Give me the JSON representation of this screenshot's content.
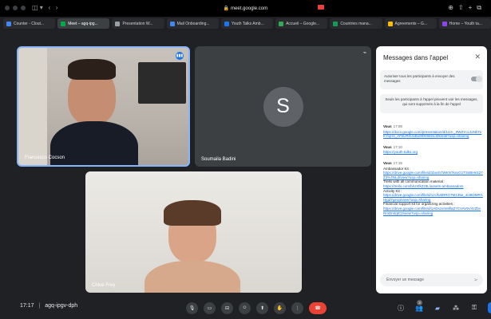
{
  "browser": {
    "url": "meet.google.com",
    "tabs": [
      {
        "label": "Counter - Clout...",
        "icon": "chrome-icon",
        "active": false,
        "color": "#4285f4"
      },
      {
        "label": "Meet – agq-ipg...",
        "icon": "meet-icon",
        "active": true,
        "color": "#00ac47"
      },
      {
        "label": "Presentation W...",
        "icon": "chrome-icon",
        "active": false,
        "color": "#9aa0a6"
      },
      {
        "label": "Mail Onboarding...",
        "icon": "gmail-icon",
        "active": false,
        "color": "#4285f4"
      },
      {
        "label": "Youth Talks Amb...",
        "icon": "facebook-icon",
        "active": false,
        "color": "#1877f2"
      },
      {
        "label": "Accueil – Google...",
        "icon": "drive-icon",
        "active": false,
        "color": "#34a853"
      },
      {
        "label": "Countries mana...",
        "icon": "sheets-icon",
        "active": false,
        "color": "#0f9d58"
      },
      {
        "label": "Agreements – G...",
        "icon": "drive-icon",
        "active": false,
        "color": "#fbbc04"
      },
      {
        "label": "Home – Youth ta...",
        "icon": "notion-icon",
        "active": false,
        "color": "#8e44ec"
      }
    ]
  },
  "participants": [
    {
      "name": "Francesco Cocson",
      "type": "video",
      "speaking": true
    },
    {
      "name": "Soumaila Badini",
      "type": "avatar",
      "initial": "S"
    },
    {
      "name": "Chloe Frey",
      "type": "video"
    }
  ],
  "chat": {
    "title": "Messages dans l'appel",
    "allow_label": "Autoriser tous les participants à envoyer des messages",
    "notice": "Seuls les participants à l'appel peuvent voir les messages, qui sont supprimés à la fin de l'appel",
    "messages": [
      {
        "sender": "Vous",
        "time": "17:08",
        "lines": [
          {
            "type": "link",
            "text": "https://docs.google.com/presentation/d/1U4-_9WZYcL3zNbToKYxjHs_AFkURGJxBv08Xr6M1IJZk/edit?usp=sharing"
          }
        ]
      },
      {
        "sender": "Vous",
        "time": "17:10",
        "lines": [
          {
            "type": "link",
            "text": "https://youth-talks.org"
          }
        ]
      },
      {
        "sender": "Vous",
        "time": "17:15",
        "lines": [
          {
            "type": "text",
            "text": "Ambassador Kit :"
          },
          {
            "type": "link",
            "text": "https://drive.google.com/file/d/1bosh7WKN7ksxG1TSsBHkS27Z3%4NLd/view?usp=sharing"
          },
          {
            "type": "text",
            "text": "Trello with all communication material :"
          },
          {
            "type": "link",
            "text": "https://trello.com/b/UXfkZz8L/assets-ambassadors"
          },
          {
            "type": "text",
            "text": "Activity Kit :"
          },
          {
            "type": "link",
            "text": "https://drive.google.com/file/d/1zUfo5RRO7M135e_4c8tOMRXHjgZ7ge1p/view?usp=sharing"
          },
          {
            "type": "text",
            "text": "Financial support kit for organizing activities :"
          },
          {
            "type": "link",
            "text": "https://drive.google.com/file/d/1ADszemMllaZ7CVAV5V4zZbvRmDmtqtC2/view?usp=sharing"
          }
        ]
      }
    ],
    "input_placeholder": "Envoyer un message"
  },
  "meeting": {
    "time": "17:17",
    "code": "agq-ipgv-dph"
  },
  "controls": [
    "microphone-icon",
    "camera-icon",
    "captions-icon",
    "emoji-icon",
    "present-icon",
    "raise-hand-icon",
    "more-icon",
    "end-call-icon"
  ],
  "side_controls": {
    "people_count": "3"
  }
}
